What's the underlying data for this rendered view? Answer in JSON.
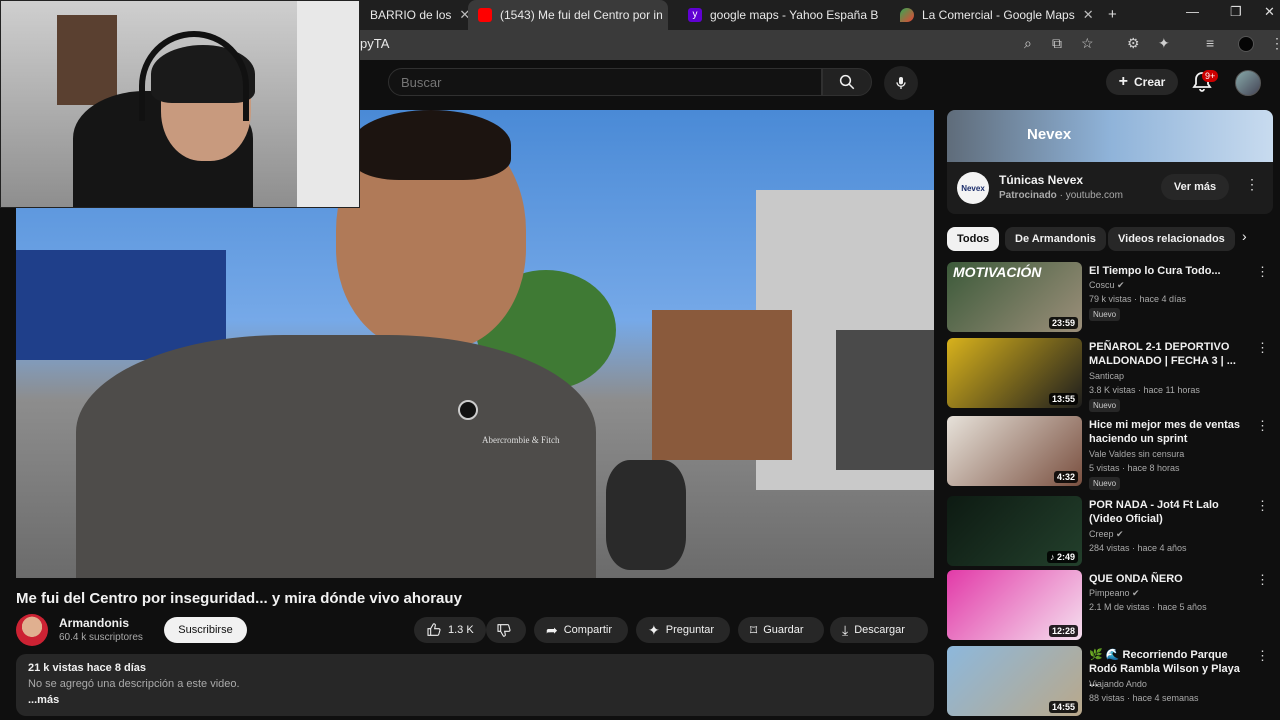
{
  "browser": {
    "tabs": [
      {
        "label": "BARRIO de los"
      },
      {
        "label": "(1543) Me fui del Centro por in"
      },
      {
        "label": "google maps - Yahoo España B"
      },
      {
        "label": "La Comercial - Google Maps"
      }
    ],
    "url_fragment": "pyTA"
  },
  "header": {
    "search_placeholder": "Buscar",
    "create_label": "Crear",
    "notif_badge": "9+"
  },
  "video": {
    "title": "Me fui del Centro por inseguridad... y mira dónde vivo ahorauy",
    "channel": "Armandonis",
    "subscribers": "60.4 k suscriptores",
    "subscribe_label": "Suscribirse",
    "likes": "1.3 K",
    "share_label": "Compartir",
    "ask_label": "Preguntar",
    "save_label": "Guardar",
    "download_label": "Descargar",
    "views_date": "21 k vistas  hace 8 días",
    "description": "No se agregó una descripción a este video.",
    "more_label": "...más",
    "overlay_text": "Abercrombie & Fitch"
  },
  "ad": {
    "banner_text": "Nevex",
    "logo_text": "Nevex",
    "title": "Túnicas Nevex",
    "sponsored": "Patrocinado",
    "domain": "youtube.com",
    "cta": "Ver más"
  },
  "chips": [
    "Todos",
    "De Armandonis",
    "Videos relacionados"
  ],
  "recommended": [
    {
      "title": "El Tiempo lo Cura Todo...",
      "channel": "Coscu",
      "verified": true,
      "meta": "79 k vistas · hace 4 días",
      "badge": "Nuevo",
      "duration": "23:59",
      "thumb_text": "MOTIVACIÓN",
      "color1": "#3c5a3a",
      "color2": "#9c8f7a"
    },
    {
      "title": "PEÑAROL 2-1 DEPORTIVO MALDONADO | FECHA 3 | ...",
      "channel": "Santicap",
      "verified": false,
      "meta": "3.8 K vistas · hace 11 horas",
      "badge": "Nuevo",
      "duration": "13:55",
      "thumb_text": "",
      "color1": "#d8b21c",
      "color2": "#1d1d1d"
    },
    {
      "title": "Hice mi mejor mes de ventas haciendo un sprint",
      "channel": "Vale Valdes sin censura",
      "verified": false,
      "meta": "5 vistas · hace 8 horas",
      "badge": "Nuevo",
      "duration": "4:32",
      "thumb_text": "",
      "color1": "#e7e2da",
      "color2": "#7a5040"
    },
    {
      "title": "POR NADA - Jot4 Ft Lalo (Video Oficial)",
      "channel": "Creep",
      "verified": true,
      "meta": "284 vistas · hace 4 años",
      "badge": "",
      "duration": "♪ 2:49",
      "thumb_text": "",
      "color1": "#0d1a12",
      "color2": "#23402c"
    },
    {
      "title": "QUE ONDA ÑERO",
      "channel": "Pimpeano",
      "verified": true,
      "meta": "2.1 M de vistas · hace 5 años",
      "badge": "",
      "duration": "12:28",
      "thumb_text": "",
      "color1": "#e23aa8",
      "color2": "#f5e0ef"
    },
    {
      "title": "🌿 🌊 Recorriendo Parque Rodó Rambla Wilson y Playa ...",
      "channel": "Viajando Ando",
      "verified": false,
      "meta": "88 vistas · hace 4 semanas",
      "badge": "",
      "duration": "14:55",
      "thumb_text": "",
      "color1": "#8db8dc",
      "color2": "#b9a88a"
    }
  ],
  "colors": {
    "accent_red": "#cc0000",
    "bg": "#0f0f0f",
    "surface": "#272727"
  }
}
